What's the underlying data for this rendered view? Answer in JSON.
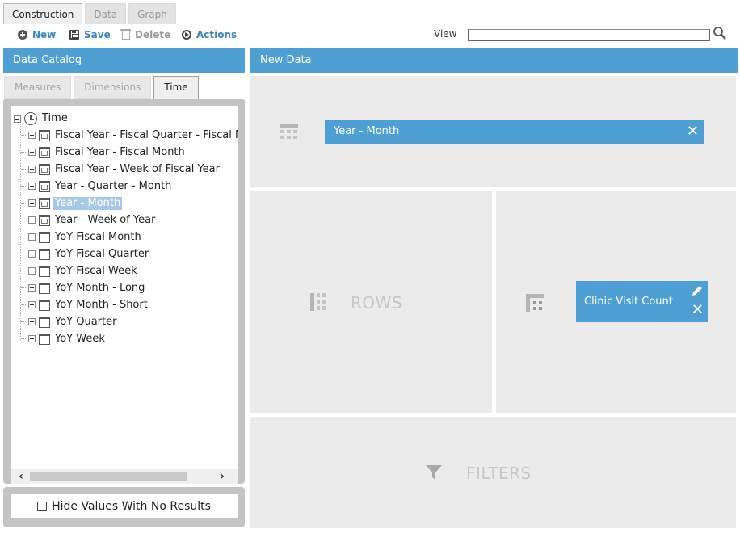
{
  "top_tabs": [
    {
      "label": "Construction",
      "active": true
    },
    {
      "label": "Data",
      "active": false
    },
    {
      "label": "Graph",
      "active": false
    }
  ],
  "toolbar": {
    "new_label": "New",
    "save_label": "Save",
    "delete_label": "Delete",
    "actions_label": "Actions",
    "view_label": "View",
    "view_value": ""
  },
  "data_catalog": {
    "title": "Data Catalog",
    "tabs": [
      {
        "label": "Measures",
        "active": false
      },
      {
        "label": "Dimensions",
        "active": false
      },
      {
        "label": "Time",
        "active": true
      }
    ],
    "tree": {
      "root_label": "Time",
      "items": [
        {
          "label": "Fiscal Year - Fiscal Quarter - Fiscal M",
          "icon": "hierarchy-calendar-icon"
        },
        {
          "label": "Fiscal Year - Fiscal Month",
          "icon": "hierarchy-calendar-icon"
        },
        {
          "label": "Fiscal Year - Week of Fiscal Year",
          "icon": "hierarchy-calendar-icon"
        },
        {
          "label": "Year - Quarter - Month",
          "icon": "hierarchy-calendar-icon"
        },
        {
          "label": "Year - Month",
          "icon": "hierarchy-calendar-icon",
          "selected": true
        },
        {
          "label": "Year - Week of Year",
          "icon": "hierarchy-calendar-icon"
        },
        {
          "label": "YoY Fiscal Month",
          "icon": "calendar-icon"
        },
        {
          "label": "YoY Fiscal Quarter",
          "icon": "calendar-icon"
        },
        {
          "label": "YoY Fiscal Week",
          "icon": "calendar-icon"
        },
        {
          "label": "YoY Month - Long",
          "icon": "calendar-icon"
        },
        {
          "label": "YoY Month - Short",
          "icon": "calendar-icon"
        },
        {
          "label": "YoY Quarter",
          "icon": "calendar-icon"
        },
        {
          "label": "YoY Week",
          "icon": "calendar-icon"
        }
      ]
    },
    "hide_values_label": "Hide Values With No Results",
    "hide_values_checked": false
  },
  "new_data": {
    "title": "New Data",
    "columns_chip": "Year - Month",
    "rows_label": "ROWS",
    "measure_chip": "Clinic Visit Count",
    "filters_label": "FILTERS"
  },
  "colors": {
    "accent": "#4e9fd4",
    "zone_bg": "#ebebeb",
    "selection": "#a8c8e8"
  }
}
